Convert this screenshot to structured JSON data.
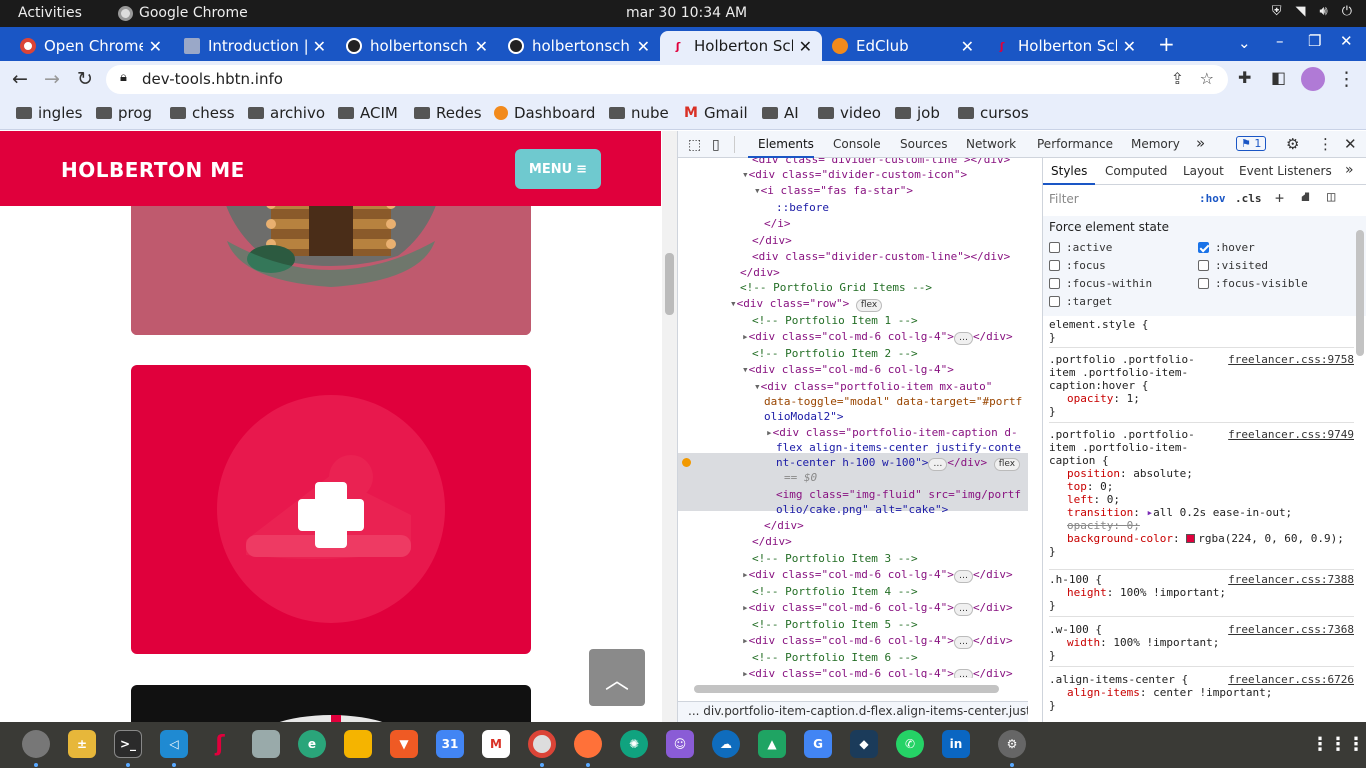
{
  "system": {
    "activities": "Activities",
    "app_name": "Google Chrome",
    "clock": "mar 30  10:34 AM"
  },
  "tabs": [
    {
      "title": "Open Chrome",
      "icon": "chrome-icon"
    },
    {
      "title": "Introduction | ",
      "icon": "book-icon"
    },
    {
      "title": "holbertonsch",
      "icon": "github-icon"
    },
    {
      "title": "holbertonsch",
      "icon": "github-icon"
    },
    {
      "title": "Holberton Sch",
      "icon": "holberton-icon",
      "active": true
    },
    {
      "title": "EdClub",
      "icon": "edclub-icon"
    },
    {
      "title": "Holberton Sch",
      "icon": "holberton-icon"
    }
  ],
  "address_bar": {
    "url": "dev-tools.hbtn.info"
  },
  "bookmarks": [
    "ingles",
    "prog",
    "chess",
    "archivo",
    "ACIM",
    "Redes",
    "Dashboard",
    "nube",
    "Gmail",
    "AI",
    "video",
    "job",
    "cursos"
  ],
  "website": {
    "brand": "HOLBERTON ME",
    "menu_label": "MENU",
    "colors": {
      "brand": "#e0003c",
      "menu": "#6fc9cf",
      "card_hover": "rgba(224, 0, 60, 0.9)"
    }
  },
  "devtools": {
    "tabs": [
      "Elements",
      "Console",
      "Sources",
      "Network",
      "Performance",
      "Memory"
    ],
    "issues_count": "1",
    "elements_lines": [
      {
        "i": 0,
        "html": "<div class=\"divider-custom-line\"></div>"
      },
      {
        "i": 1,
        "html": "<div class=\"divider-custom-icon\">"
      },
      {
        "i": 2,
        "html": "<i class=\"fas fa-star\">"
      },
      {
        "i": 3,
        "html": "::before"
      },
      {
        "i": 4,
        "html": "</i>"
      },
      {
        "i": 5,
        "html": "</div>"
      },
      {
        "i": 6,
        "html": "<div class=\"divider-custom-line\"></div>"
      },
      {
        "i": 7,
        "html": "</div>"
      },
      {
        "i": 8,
        "html": "<!-- Portfolio Grid Items -->"
      },
      {
        "i": 9,
        "html": "<div class=\"row\">"
      },
      {
        "i": 10,
        "html": "<!-- Portfolio Item 1 -->"
      },
      {
        "i": 11,
        "html": "<div class=\"col-md-6 col-lg-4\">"
      },
      {
        "i": 12,
        "html": "<!-- Portfolio Item 2 -->"
      },
      {
        "i": 13,
        "html": "<div class=\"col-md-6 col-lg-4\">"
      },
      {
        "i": 14,
        "html": "<div class=\"portfolio-item mx-auto\""
      },
      {
        "i": 15,
        "html": "data-toggle=\"modal\" data-target=\"#portf"
      },
      {
        "i": 16,
        "html": "olioModal2\">"
      },
      {
        "i": 17,
        "html": "<div class=\"portfolio-item-caption d-"
      },
      {
        "i": 18,
        "html": "flex align-items-center justify-conte"
      },
      {
        "i": 19,
        "html": "nt-center h-100 w-100\">"
      },
      {
        "i": 20,
        "html": "== $0"
      },
      {
        "i": 21,
        "html": "<img class=\"img-fluid\" src=\"img/portf"
      },
      {
        "i": 22,
        "html": "olio/cake.png\" alt=\"cake\">"
      },
      {
        "i": 23,
        "html": "</div>"
      },
      {
        "i": 24,
        "html": "</div>"
      },
      {
        "i": 25,
        "html": "<!-- Portfolio Item 3 -->"
      },
      {
        "i": 26,
        "html": "<div class=\"col-md-6 col-lg-4\">"
      },
      {
        "i": 27,
        "html": "<!-- Portfolio Item 4 -->"
      },
      {
        "i": 28,
        "html": "<div class=\"col-md-6 col-lg-4\">"
      },
      {
        "i": 29,
        "html": "<!-- Portfolio Item 5 -->"
      },
      {
        "i": 30,
        "html": "<div class=\"col-md-6 col-lg-4\">"
      },
      {
        "i": 31,
        "html": "<!-- Portfolio Item 6 -->"
      },
      {
        "i": 32,
        "html": "<div class=\"col-md-6 col-lg-4\">"
      }
    ],
    "breadcrumb": "...  div.portfolio-item-caption.d-flex.align-items-center.just",
    "styles_tabs": [
      "Styles",
      "Computed",
      "Layout",
      "Event Listeners"
    ],
    "filter_placeholder": "Filter",
    "hov": ":hov",
    "cls": ".cls",
    "force_state_title": "Force element state",
    "states": [
      {
        "label": ":active",
        "checked": false
      },
      {
        "label": ":hover",
        "checked": true
      },
      {
        "label": ":focus",
        "checked": false
      },
      {
        "label": ":visited",
        "checked": false
      },
      {
        "label": ":focus-within",
        "checked": false
      },
      {
        "label": ":focus-visible",
        "checked": false
      },
      {
        "label": ":target",
        "checked": false
      }
    ],
    "rules": [
      {
        "selector": "element.style {",
        "source": "",
        "props": []
      },
      {
        "selector": ".portfolio .portfolio-item .portfolio-item-caption:hover {",
        "source": "freelancer.css:9758",
        "props": [
          {
            "p": "opacity",
            "v": "1;"
          }
        ]
      },
      {
        "selector": ".portfolio .portfolio-item .portfolio-item-caption {",
        "source": "freelancer.css:9749",
        "props": [
          {
            "p": "position",
            "v": "absolute;"
          },
          {
            "p": "top",
            "v": "0;"
          },
          {
            "p": "left",
            "v": "0;"
          },
          {
            "p": "transition",
            "v": "all 0.2s ease-in-out;"
          },
          {
            "p": "opacity",
            "v": "0;",
            "struck": true
          },
          {
            "p": "background-color",
            "v": "rgba(224, 0, 60, 0.9);"
          }
        ]
      },
      {
        "selector": ".h-100 {",
        "source": "freelancer.css:7388",
        "props": [
          {
            "p": "height",
            "v": "100% !important;"
          }
        ]
      },
      {
        "selector": ".w-100 {",
        "source": "freelancer.css:7368",
        "props": [
          {
            "p": "width",
            "v": "100% !important;"
          }
        ]
      },
      {
        "selector": ".align-items-center {",
        "source": "freelancer.css:6726",
        "props": [
          {
            "p": "align-items",
            "v": "center !important;"
          }
        ]
      }
    ]
  }
}
